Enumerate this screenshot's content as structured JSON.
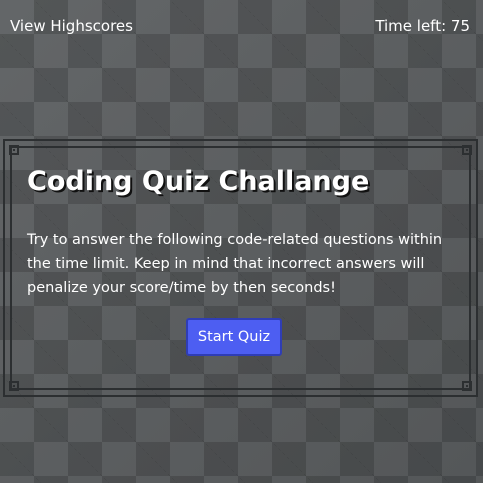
{
  "header": {
    "highscores_link": "View Highscores",
    "timer_label": "Time left: ",
    "timer_value": "75"
  },
  "quiz": {
    "title": "Coding Quiz Challange",
    "description": "Try to answer the following code-related questions within the time limit. Keep in mind that incorrect answers will penalize your score/time by then seconds!",
    "start_button": "Start Quiz"
  },
  "colors": {
    "background": "#5b5e60",
    "frame": "#2c2f31",
    "button": "#4d5ef2",
    "text": "#ffffff"
  }
}
